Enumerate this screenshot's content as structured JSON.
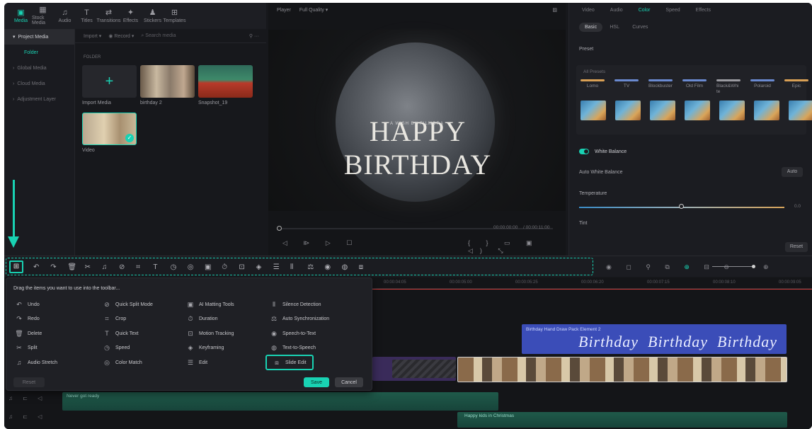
{
  "nav": [
    {
      "label": "Media",
      "icon": "media-icon"
    },
    {
      "label": "Stock Media",
      "icon": "stock-media-icon"
    },
    {
      "label": "Audio",
      "icon": "audio-icon"
    },
    {
      "label": "Titles",
      "icon": "titles-icon"
    },
    {
      "label": "Transitions",
      "icon": "transitions-icon"
    },
    {
      "label": "Effects",
      "icon": "effects-icon"
    },
    {
      "label": "Stickers",
      "icon": "stickers-icon"
    },
    {
      "label": "Templates",
      "icon": "templates-icon"
    }
  ],
  "sidebar": {
    "project_media": "Project Media",
    "folder": "Folder",
    "items": [
      "Global Media",
      "Cloud Media",
      "Adjustment Layer"
    ]
  },
  "media": {
    "import": "Import",
    "record": "Record",
    "search_placeholder": "Search media",
    "folder_label": "FOLDER",
    "items": [
      {
        "label": "Import Media"
      },
      {
        "label": "birthday 2"
      },
      {
        "label": "Snapshot_19"
      },
      {
        "label": "Video"
      }
    ]
  },
  "player": {
    "label": "Player",
    "quality": "Full Quality",
    "title": "HAPPY BIRTHDAY",
    "subtitle": "A WISH BY FILMORA",
    "time_current": "00:00:00:00",
    "time_total": "/ 00:00:11:00"
  },
  "properties": {
    "tabs": [
      "Video",
      "Audio",
      "Color",
      "Speed",
      "Effects"
    ],
    "subtabs": [
      "Basic",
      "HSL",
      "Curves"
    ],
    "preset_label": "Preset",
    "all_presets": "All Presets",
    "presets": [
      "Lomo",
      "TV",
      "Blockbuster",
      "Old Film",
      "Black&Whi te",
      "Polaroid",
      "Epic"
    ],
    "white_balance": "White Balance",
    "auto_white_balance": "Auto White Balance",
    "auto": "Auto",
    "temperature": "Temperature",
    "temperature_value": "0.0",
    "tint": "Tint",
    "reset": "Reset"
  },
  "timeline": {
    "ruler": [
      "00:00:04:05",
      "00:00:05:00",
      "00:00:05:25",
      "00:00:06:20",
      "00:00:07:15",
      "00:00:08:10",
      "00:00:09:05"
    ],
    "title_clip": "Birthday Hand Draw Pack Element 2",
    "title_text": "Birthday",
    "audio1": "Never got ready",
    "audio2": "Happy kids in Christmas"
  },
  "toolbar_panel": {
    "heading": "Drag the items you want to use into the toolbar...",
    "options": [
      {
        "label": "Undo",
        "icon": "undo-icon",
        "glyph": "↶"
      },
      {
        "label": "Redo",
        "icon": "redo-icon",
        "glyph": "↷"
      },
      {
        "label": "Delete",
        "icon": "delete-icon",
        "glyph": "🗑"
      },
      {
        "label": "Split",
        "icon": "split-icon",
        "glyph": "✂"
      },
      {
        "label": "Audio Stretch",
        "icon": "audio-stretch-icon",
        "glyph": "♫"
      },
      {
        "label": "Quick Split Mode",
        "icon": "quick-split-icon",
        "glyph": "⊘"
      },
      {
        "label": "Crop",
        "icon": "crop-icon",
        "glyph": "⌗"
      },
      {
        "label": "Quick Text",
        "icon": "quick-text-icon",
        "glyph": "T"
      },
      {
        "label": "Speed",
        "icon": "speed-icon",
        "glyph": "◷"
      },
      {
        "label": "Color Match",
        "icon": "color-match-icon",
        "glyph": "◎"
      },
      {
        "label": "AI Matting Tools",
        "icon": "ai-matting-icon",
        "glyph": "▣"
      },
      {
        "label": "Duration",
        "icon": "duration-icon",
        "glyph": "⏱"
      },
      {
        "label": "Motion Tracking",
        "icon": "motion-tracking-icon",
        "glyph": "⊡"
      },
      {
        "label": "Keyframing",
        "icon": "keyframing-icon",
        "glyph": "◈"
      },
      {
        "label": "Edit",
        "icon": "edit-icon",
        "glyph": "☰"
      },
      {
        "label": "Silence Detection",
        "icon": "silence-detection-icon",
        "glyph": "⫴"
      },
      {
        "label": "Auto Synchronization",
        "icon": "auto-sync-icon",
        "glyph": "⚖"
      },
      {
        "label": "Speech-to-Text",
        "icon": "speech-to-text-icon",
        "glyph": "◉"
      },
      {
        "label": "Text-to-Speech",
        "icon": "text-to-speech-icon",
        "glyph": "◍"
      },
      {
        "label": "Slide Edit",
        "icon": "slide-edit-icon",
        "glyph": "⧈"
      }
    ],
    "reset": "Reset",
    "save": "Save",
    "cancel": "Cancel"
  },
  "colors": {
    "accent": "#19d2b3",
    "bg": "#17181c",
    "title_track": "#3b4db8",
    "video_track": "#6a4a2a",
    "audio_track": "#1f5a4a"
  }
}
